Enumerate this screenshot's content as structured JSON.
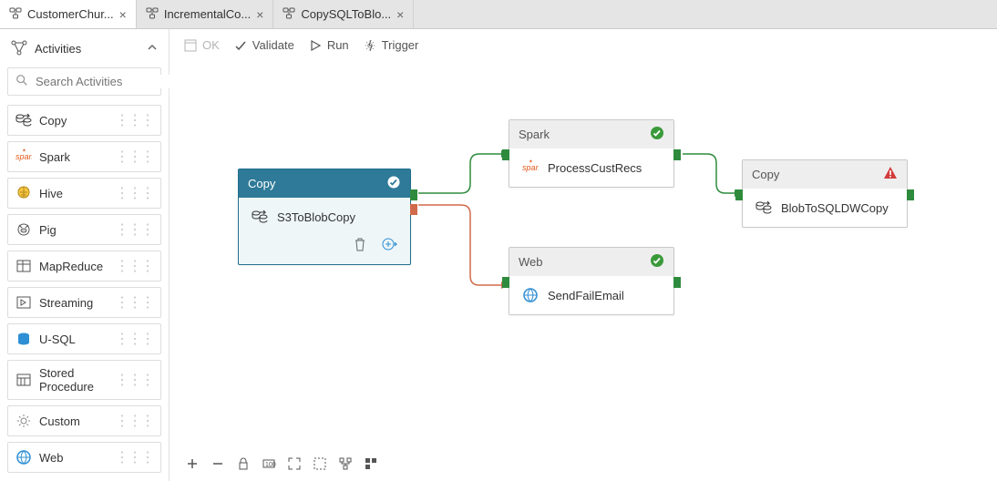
{
  "tabs": [
    {
      "label": "CustomerChur...",
      "active": true
    },
    {
      "label": "IncrementalCo...",
      "active": false
    },
    {
      "label": "CopySQLToBlo...",
      "active": false
    }
  ],
  "sidebar": {
    "title": "Activities",
    "search_placeholder": "Search Activities",
    "items": [
      {
        "label": "Copy"
      },
      {
        "label": "Spark"
      },
      {
        "label": "Hive"
      },
      {
        "label": "Pig"
      },
      {
        "label": "MapReduce"
      },
      {
        "label": "Streaming"
      },
      {
        "label": "U-SQL"
      },
      {
        "label": "Stored Procedure"
      },
      {
        "label": "Custom"
      },
      {
        "label": "Web"
      }
    ]
  },
  "toolbar": {
    "ok": "OK",
    "validate": "Validate",
    "run": "Run",
    "trigger": "Trigger"
  },
  "nodes": {
    "s3": {
      "type": "Copy",
      "name": "S3ToBlobCopy"
    },
    "proc": {
      "type": "Spark",
      "name": "ProcessCustRecs"
    },
    "web": {
      "type": "Web",
      "name": "SendFailEmail"
    },
    "blob": {
      "type": "Copy",
      "name": "BlobToSQLDWCopy"
    }
  }
}
